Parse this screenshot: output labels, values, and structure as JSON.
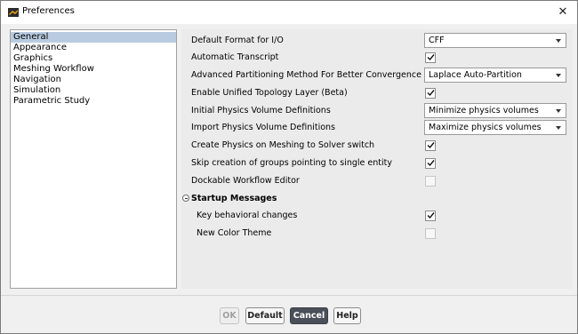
{
  "window": {
    "title": "Preferences",
    "close_symbol": "✕"
  },
  "nav": {
    "items": [
      {
        "label": "General",
        "selected": true
      },
      {
        "label": "Appearance",
        "selected": false
      },
      {
        "label": "Graphics",
        "selected": false
      },
      {
        "label": "Meshing Workflow",
        "selected": false
      },
      {
        "label": "Navigation",
        "selected": false
      },
      {
        "label": "Simulation",
        "selected": false
      },
      {
        "label": "Parametric Study",
        "selected": false
      }
    ]
  },
  "settings": {
    "default_format": {
      "label": "Default Format for I/O",
      "value": "CFF"
    },
    "automatic_transcript": {
      "label": "Automatic Transcript",
      "checked": true
    },
    "partitioning_method": {
      "label": "Advanced Partitioning Method For Better Convergence",
      "value": "Laplace Auto-Partition"
    },
    "unified_topology": {
      "label": "Enable Unified Topology Layer (Beta)",
      "checked": true
    },
    "initial_physics": {
      "label": "Initial Physics Volume Definitions",
      "value": "Minimize physics volumes"
    },
    "import_physics": {
      "label": "Import Physics Volume Definitions",
      "value": "Maximize physics volumes"
    },
    "create_physics": {
      "label": "Create Physics on Meshing to Solver switch",
      "checked": true
    },
    "skip_groups": {
      "label": "Skip creation of groups pointing to single entity",
      "checked": true
    },
    "dockable_editor": {
      "label": "Dockable Workflow Editor",
      "checked": false
    }
  },
  "startup": {
    "title": "Startup Messages",
    "key_behavioral": {
      "label": "Key behavioral changes",
      "checked": true
    },
    "new_color_theme": {
      "label": "New Color Theme",
      "checked": false
    }
  },
  "buttons": {
    "ok": "OK",
    "default": "Default",
    "cancel": "Cancel",
    "help": "Help"
  },
  "colors": {
    "selection": "#b8cbe0",
    "panel_bg": "#ebebeb",
    "cancel_bg": "#4a4f59",
    "icon_accent": "#e8a317"
  }
}
